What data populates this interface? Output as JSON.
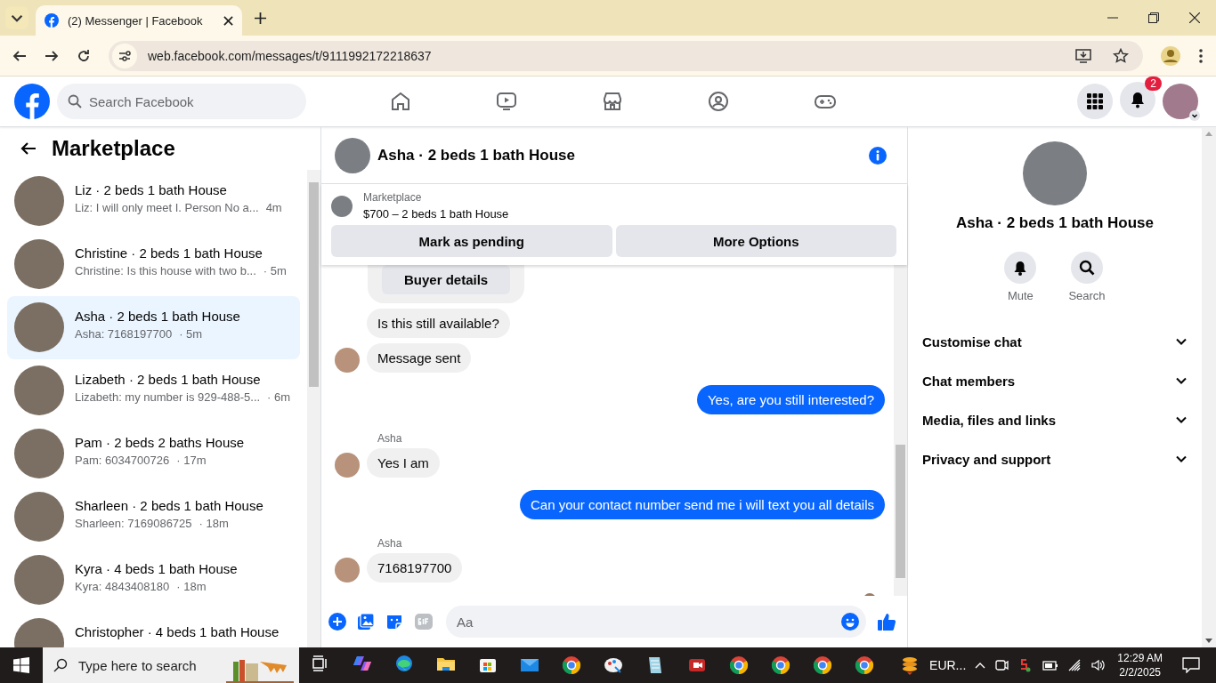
{
  "browser": {
    "tab": {
      "title": "(2) Messenger | Facebook"
    },
    "url": "web.facebook.com/messages/t/9111992172218637"
  },
  "topbar": {
    "search": {
      "placeholder": "Search Facebook"
    },
    "notification_count": "2"
  },
  "sidebar": {
    "title": "Marketplace",
    "conversations": [
      {
        "title": "Liz · 2 beds 1 bath House",
        "preview": "Liz: I will only meet I. Person No a...",
        "time": "4m",
        "selected": false
      },
      {
        "title": "Christine · 2 beds 1 bath House",
        "preview": "Christine: Is this house with two b...",
        "time": "· 5m",
        "selected": false
      },
      {
        "title": "Asha · 2 beds 1 bath House",
        "preview": "Asha: 7168197700",
        "time": "· 5m",
        "selected": true
      },
      {
        "title": "Lizabeth · 2 beds 1 bath House",
        "preview": "Lizabeth: my number is 929-488-5...",
        "time": "· 6m",
        "selected": false
      },
      {
        "title": "Pam · 2 beds 2 baths House",
        "preview": "Pam: 6034700726",
        "time": "· 17m",
        "selected": false
      },
      {
        "title": "Sharleen · 2 beds 1 bath House",
        "preview": "Sharleen: 7169086725",
        "time": "· 18m",
        "selected": false
      },
      {
        "title": "Kyra · 4 beds 1 bath House",
        "preview": "Kyra: 4843408180",
        "time": "· 18m",
        "selected": false
      },
      {
        "title": "Christopher · 4 beds 1 bath House",
        "selected": false
      }
    ]
  },
  "chat": {
    "title": "Asha · 2 beds 1 bath House",
    "listing": {
      "label": "Marketplace",
      "title": "$700 – 2 beds 1 bath House"
    },
    "actions": [
      "Mark as pending",
      "More Options"
    ],
    "messages": [
      {
        "kind": "card",
        "text": "Buyer details"
      },
      {
        "kind": "incoming",
        "text": "Is this still available?",
        "avatar": false
      },
      {
        "kind": "incoming",
        "text": "Message sent",
        "avatar": true
      },
      {
        "kind": "outgoing",
        "text": "Yes, are you still interested?"
      },
      {
        "kind": "incoming",
        "sender": "Asha",
        "text": "Yes I am",
        "avatar": true
      },
      {
        "kind": "outgoing",
        "text": "Can your contact number send me i will text you all details"
      },
      {
        "kind": "incoming",
        "sender": "Asha",
        "text": "7168197700",
        "avatar": true
      }
    ],
    "composer": {
      "placeholder": "Aa"
    }
  },
  "details": {
    "title": "Asha · 2 beds 1 bath House",
    "actions": [
      {
        "kind": "mute",
        "label": "Mute"
      },
      {
        "kind": "search",
        "label": "Search"
      }
    ],
    "sections": [
      {
        "label": "Customise chat",
        "expanded": false
      },
      {
        "label": "Chat members",
        "expanded": false
      },
      {
        "label": "Media, files and links",
        "expanded": false
      },
      {
        "label": "Privacy and support",
        "expanded": false
      }
    ]
  },
  "taskbar": {
    "search": {
      "placeholder": "Type here to search"
    },
    "tray_label": "EUR...",
    "time": "12:29 AM",
    "date": "2/2/2025"
  }
}
